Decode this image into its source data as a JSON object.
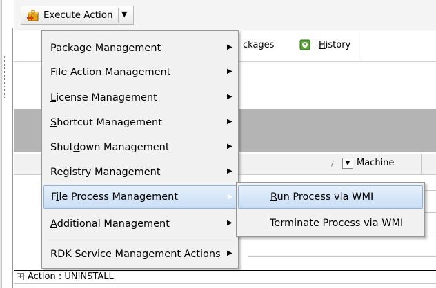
{
  "toolbar": {
    "execute_action": {
      "prefix": "",
      "mnemonic": "E",
      "rest": "xecute Action"
    },
    "dropdown_arrow": "▼"
  },
  "tabs": {
    "packages_partial": "ckages",
    "history": {
      "mnemonic": "H",
      "rest": "istory"
    }
  },
  "grid": {
    "sort_indicator": "/",
    "filter_glyph": "▼",
    "machine_column": "Machine",
    "action_row_expander": "+",
    "action_row_text": "Action : UNINSTALL"
  },
  "menu": {
    "items": [
      {
        "pre": "",
        "mnemonic": "P",
        "post": "ackage Management",
        "has_submenu": true
      },
      {
        "pre": "",
        "mnemonic": "F",
        "post": "ile Action Management",
        "has_submenu": true
      },
      {
        "pre": "",
        "mnemonic": "L",
        "post": "icense Management",
        "has_submenu": true
      },
      {
        "pre": "",
        "mnemonic": "S",
        "post": "hortcut Management",
        "has_submenu": true
      },
      {
        "pre": "Shut",
        "mnemonic": "d",
        "post": "own Management",
        "has_submenu": true
      },
      {
        "pre": "",
        "mnemonic": "R",
        "post": "egistry Management",
        "has_submenu": true
      },
      {
        "pre": "F",
        "mnemonic": "i",
        "post": "le Process Management",
        "has_submenu": true,
        "active": true
      },
      {
        "pre": "",
        "mnemonic": "A",
        "post": "dditional Management",
        "has_submenu": true
      },
      {
        "pre": "RDK Service Management Actions",
        "mnemonic": "",
        "post": "",
        "has_submenu": true
      }
    ],
    "submenu_arrow": "▶"
  },
  "submenu": {
    "items": [
      {
        "pre": "",
        "mnemonic": "R",
        "post": "un Process via WMI",
        "active": true
      },
      {
        "pre": "",
        "mnemonic": "T",
        "post": "erminate Process via WMI"
      }
    ]
  },
  "colors": {
    "highlight_fill": "#c9ddf5",
    "highlight_border": "#8db2e3",
    "menu_background": "#f1f1f1",
    "grey_band": "#b4b4b4"
  },
  "icons": {
    "execute_action": "package-run-icon",
    "history": "history-tab-icon"
  }
}
